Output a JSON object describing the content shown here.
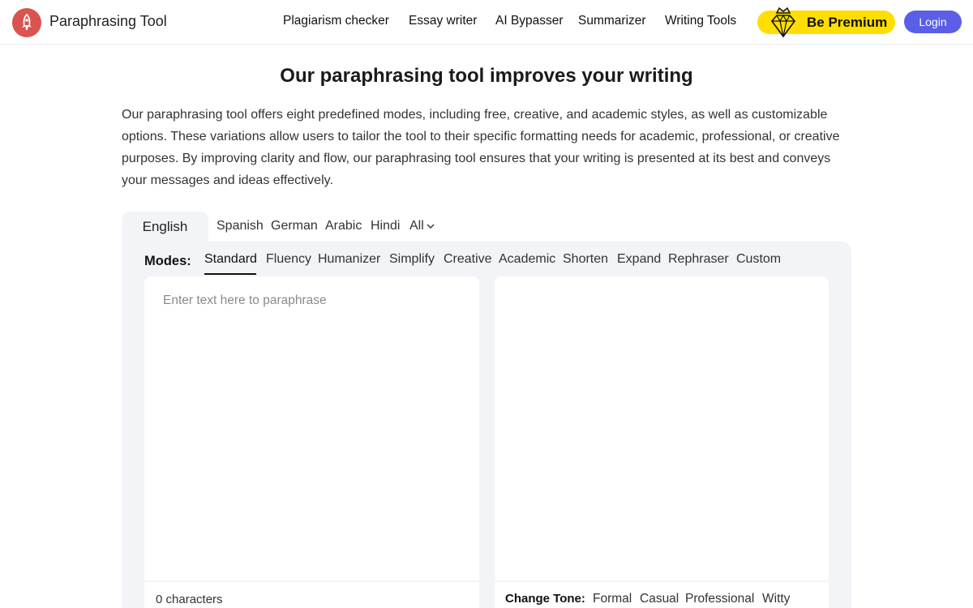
{
  "brand": {
    "name": "Paraphrasing Tool",
    "logo_icon": "rocket-icon",
    "logo_color": "#d9534f"
  },
  "nav": {
    "items": [
      "Plagiarism checker",
      "Essay writer",
      "AI Bypasser",
      "Summarizer",
      "Writing Tools"
    ],
    "premium_label": "Be Premium",
    "premium_icon": "diamond-crown-icon",
    "premium_color": "#ffde00",
    "login_label": "Login",
    "login_color": "#5b5ee6"
  },
  "intro": {
    "title": "Our paraphrasing tool improves your writing",
    "description": "Our paraphrasing tool offers eight predefined modes, including free, creative, and academic styles, as well as customizable options. These variations allow users to tailor the tool to their specific formatting needs for academic, professional, or creative purposes. By improving clarity and flow, our paraphrasing tool ensures that your writing is presented at its best and conveys your messages and ideas effectively."
  },
  "languages": {
    "active": "English",
    "items": [
      "Spanish",
      "German",
      "Arabic",
      "Hindi"
    ],
    "more_label": "All"
  },
  "modes": {
    "label": "Modes:",
    "active": "Standard",
    "items": [
      "Standard",
      "Fluency",
      "Humanizer",
      "Simplify",
      "Creative",
      "Academic",
      "Shorten",
      "Expand",
      "Rephraser",
      "Custom"
    ]
  },
  "editor": {
    "input_placeholder": "Enter text here to paraphrase",
    "input_value": "",
    "char_count": "0 characters"
  },
  "tone": {
    "label": "Change Tone:",
    "items": [
      "Formal",
      "Casual",
      "Professional",
      "Witty"
    ]
  }
}
